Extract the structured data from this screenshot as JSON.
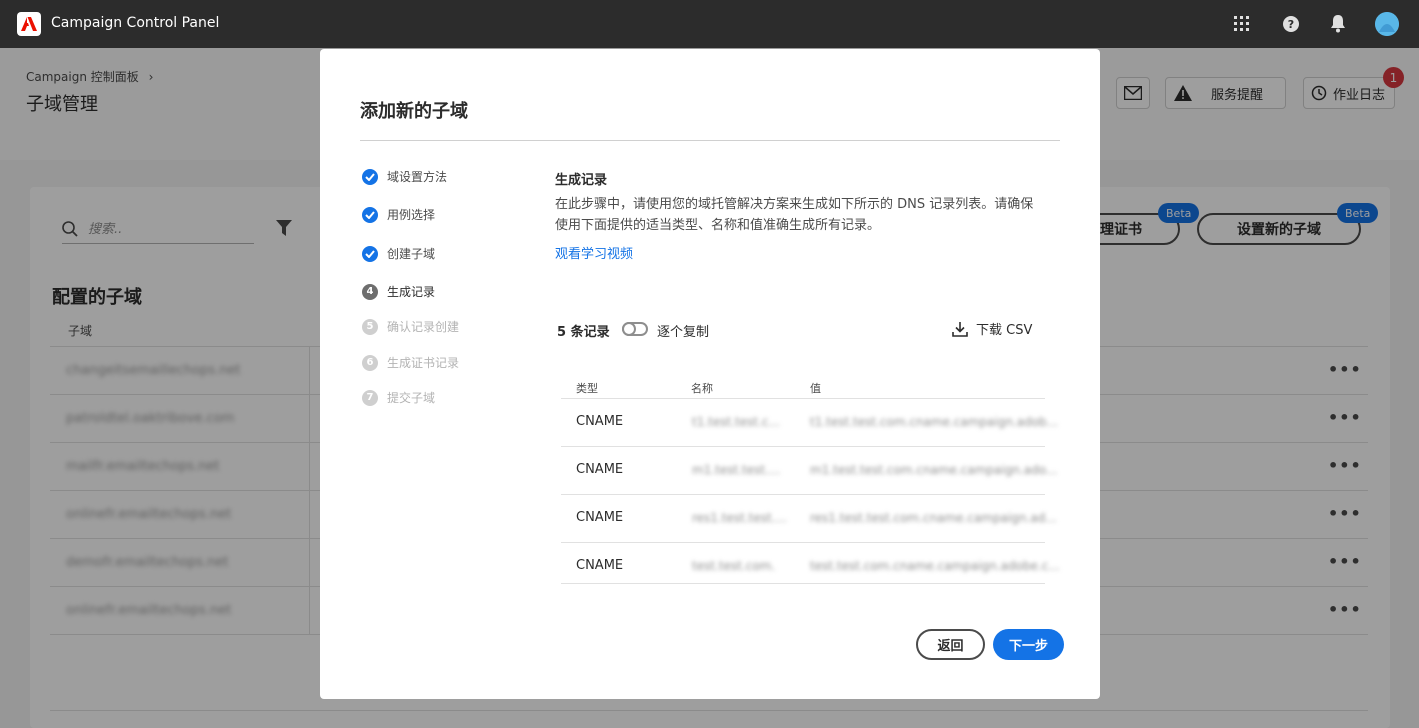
{
  "app": {
    "title": "Campaign Control Panel"
  },
  "topbar_icons": [
    "apps-grid-icon",
    "help-icon",
    "bell-icon",
    "avatar"
  ],
  "page": {
    "breadcrumb": "Campaign 控制面板",
    "breadcrumb_sep": "›",
    "title": "子域管理",
    "buttons": {
      "service_alert": "服务提醒",
      "job_log": "作业日志"
    },
    "notification_count": "1"
  },
  "list": {
    "search_placeholder": "搜索..",
    "manage_cert_label": "理证书",
    "setup_subdomain_label": "设置新的子域",
    "beta_label": "Beta",
    "section_title": "配置的子域",
    "column_header": "子域",
    "rows": [
      "changeitsemaillechops.net",
      "patroldtel.oaktribove.com",
      "mailfr.emailtechops.net",
      "onlinefr.emailtechops.net",
      "demofr.emailtechops.net",
      "onlinefr.emailtechops.net"
    ],
    "more_label": "•••"
  },
  "modal": {
    "title": "添加新的子域",
    "steps": [
      {
        "num": "1",
        "label": "域设置方法",
        "state": "done"
      },
      {
        "num": "2",
        "label": "用例选择",
        "state": "done"
      },
      {
        "num": "3",
        "label": "创建子域",
        "state": "done"
      },
      {
        "num": "4",
        "label": "生成记录",
        "state": "current"
      },
      {
        "num": "5",
        "label": "确认记录创建",
        "state": "todo"
      },
      {
        "num": "6",
        "label": "生成证书记录",
        "state": "todo"
      },
      {
        "num": "7",
        "label": "提交子域",
        "state": "todo"
      }
    ],
    "content_title": "生成记录",
    "description_line1": "在此步骤中，请使用您的域托管解决方案来生成如下所示的 DNS 记录列表。请确保",
    "description_line2": "使用下面提供的适当类型、名称和值准确生成所有记录。",
    "learn_link": "观看学习视频",
    "record_count": "5 条记录",
    "copy_toggle_label": "逐个复制",
    "download_csv": "下载 CSV",
    "table_headers": {
      "type": "类型",
      "name": "名称",
      "value": "值"
    },
    "records": [
      {
        "type": "CNAME",
        "name": "t1.test.test.c...",
        "value": "t1.test.test.com.cname.campaign.adob..."
      },
      {
        "type": "CNAME",
        "name": "m1.test.test....",
        "value": "m1.test.test.com.cname.campaign.ado..."
      },
      {
        "type": "CNAME",
        "name": "res1.test.test....",
        "value": "res1.test.test.com.cname.campaign.ad..."
      },
      {
        "type": "CNAME",
        "name": "test.test.com.",
        "value": "test.test.com.cname.campaign.adobe.c..."
      }
    ],
    "back_label": "返回",
    "next_label": "下一步"
  },
  "colors": {
    "accent": "#1473e6",
    "topbar": "#2c2c2c",
    "badge": "#d7373f",
    "beta": "#1473e6"
  }
}
